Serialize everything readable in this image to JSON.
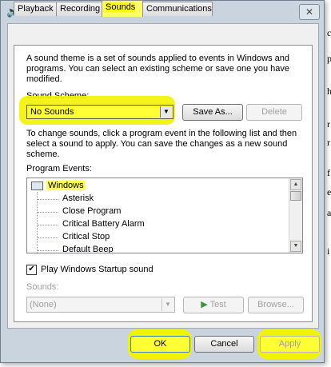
{
  "window": {
    "title": "Sound",
    "close_glyph": "✕"
  },
  "tabs": [
    {
      "label": "Playback"
    },
    {
      "label": "Recording"
    },
    {
      "label": "Sounds"
    },
    {
      "label": "Communications"
    }
  ],
  "active_tab": "Sounds",
  "sounds": {
    "description": "A sound theme is a set of sounds applied to events in Windows and programs.  You can select an existing scheme or save one you have modified.",
    "scheme_label": "Sound Scheme:",
    "scheme_value": "No Sounds",
    "save_as_label": "Save As...",
    "delete_label": "Delete",
    "change_text": "To change sounds, click a program event in the following list and then select a sound to apply.  You can save the changes as a new sound scheme.",
    "program_events_label": "Program Events:",
    "events_root": "Windows",
    "events": [
      "Asterisk",
      "Close Program",
      "Critical Battery Alarm",
      "Critical Stop",
      "Default Beep"
    ],
    "startup_checkbox_label": "Play Windows Startup sound",
    "startup_checked": true,
    "sounds_label": "Sounds:",
    "sounds_value": "(None)",
    "test_label": "Test",
    "browse_label": "Browse..."
  },
  "footer": {
    "ok_label": "OK",
    "cancel_label": "Cancel",
    "apply_label": "Apply"
  },
  "background_text": [
    "c",
    "p",
    "h",
    "r",
    "r",
    "f",
    "e",
    "a",
    "i"
  ],
  "colors": {
    "highlight": "#ffff00",
    "dialog_frame": "#c9d4de"
  }
}
